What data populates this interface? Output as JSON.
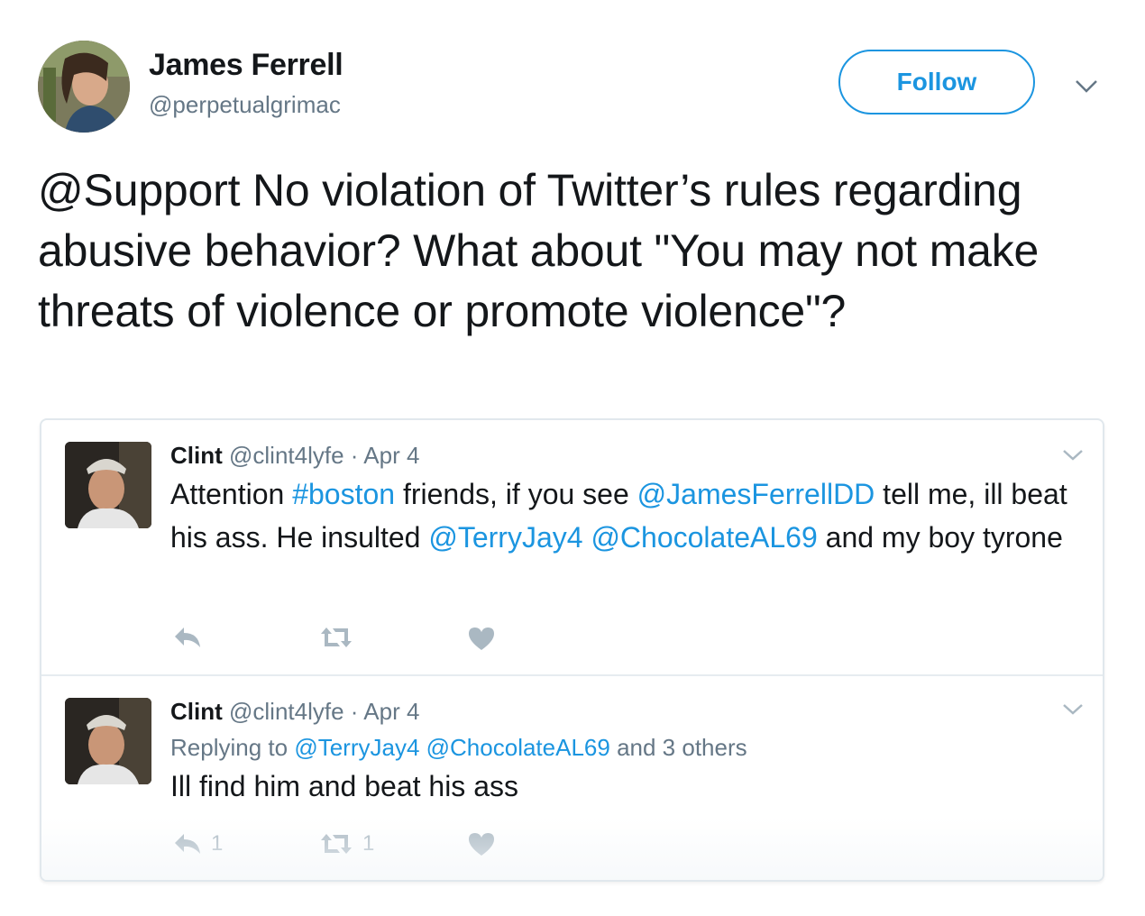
{
  "author": {
    "name": "James Ferrell",
    "handle": "@perpetualgrimac",
    "follow_label": "Follow"
  },
  "tweet": {
    "text": "@Support No violation of Twitter’s rules regarding abusive behavior? What about \"You may not make threats of violence or promote violence\"?"
  },
  "quoted": [
    {
      "name": "Clint",
      "handle": "@clint4lyfe",
      "sep": "·",
      "date": "Apr 4",
      "parts": [
        {
          "t": "Attention ",
          "link": false
        },
        {
          "t": "#boston",
          "link": true
        },
        {
          "t": " friends, if you see ",
          "link": false
        },
        {
          "t": "@JamesFerrellDD",
          "link": true
        },
        {
          "t": " tell me, ill beat his ass. He insulted ",
          "link": false
        },
        {
          "t": "@TerryJay4",
          "link": true
        },
        {
          "t": " ",
          "link": false
        },
        {
          "t": "@ChocolateAL69",
          "link": true
        },
        {
          "t": " and my boy tyrone",
          "link": false
        }
      ],
      "reply_count": "",
      "retweet_count": ""
    },
    {
      "name": "Clint",
      "handle": "@clint4lyfe",
      "sep": "·",
      "date": "Apr 4",
      "replying_prefix": "Replying to ",
      "replying_to_1": "@TerryJay4",
      "replying_to_2": "@ChocolateAL69",
      "replying_suffix": " and 3 others",
      "text": "Ill find him and beat his ass",
      "reply_count": "1",
      "retweet_count": "1"
    }
  ],
  "icons": {
    "reply": "reply-icon",
    "retweet": "retweet-icon",
    "like": "heart-icon",
    "caret": "chevron-down-icon"
  },
  "colors": {
    "accent": "#1b95e0",
    "muted": "#657786",
    "icon": "#aab8c2"
  }
}
